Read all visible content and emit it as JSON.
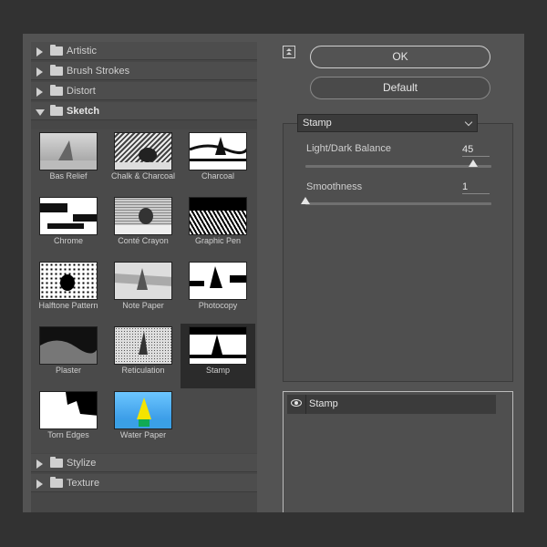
{
  "categories": [
    {
      "label": "Artistic",
      "expanded": false
    },
    {
      "label": "Brush Strokes",
      "expanded": false
    },
    {
      "label": "Distort",
      "expanded": false
    },
    {
      "label": "Sketch",
      "expanded": true
    },
    {
      "label": "Stylize",
      "expanded": false
    },
    {
      "label": "Texture",
      "expanded": false
    }
  ],
  "filters": [
    {
      "label": "Bas Relief"
    },
    {
      "label": "Chalk & Charcoal"
    },
    {
      "label": "Charcoal"
    },
    {
      "label": "Chrome"
    },
    {
      "label": "Conté Crayon"
    },
    {
      "label": "Graphic Pen"
    },
    {
      "label": "Halftone Pattern"
    },
    {
      "label": "Note Paper"
    },
    {
      "label": "Photocopy"
    },
    {
      "label": "Plaster"
    },
    {
      "label": "Reticulation"
    },
    {
      "label": "Stamp",
      "selected": true
    },
    {
      "label": "Torn Edges"
    },
    {
      "label": "Water Paper"
    }
  ],
  "buttons": {
    "ok": "OK",
    "default": "Default"
  },
  "filter_select": {
    "value": "Stamp"
  },
  "params": {
    "light_dark": {
      "label": "Light/Dark Balance",
      "value": "45",
      "fraction": 0.9
    },
    "smoothness": {
      "label": "Smoothness",
      "value": "1",
      "fraction": 0.0
    }
  },
  "layer": {
    "name": "Stamp"
  },
  "colors": {
    "accent": "#e6e6e6",
    "panel": "#535353",
    "selected": "#2b2b2b"
  }
}
